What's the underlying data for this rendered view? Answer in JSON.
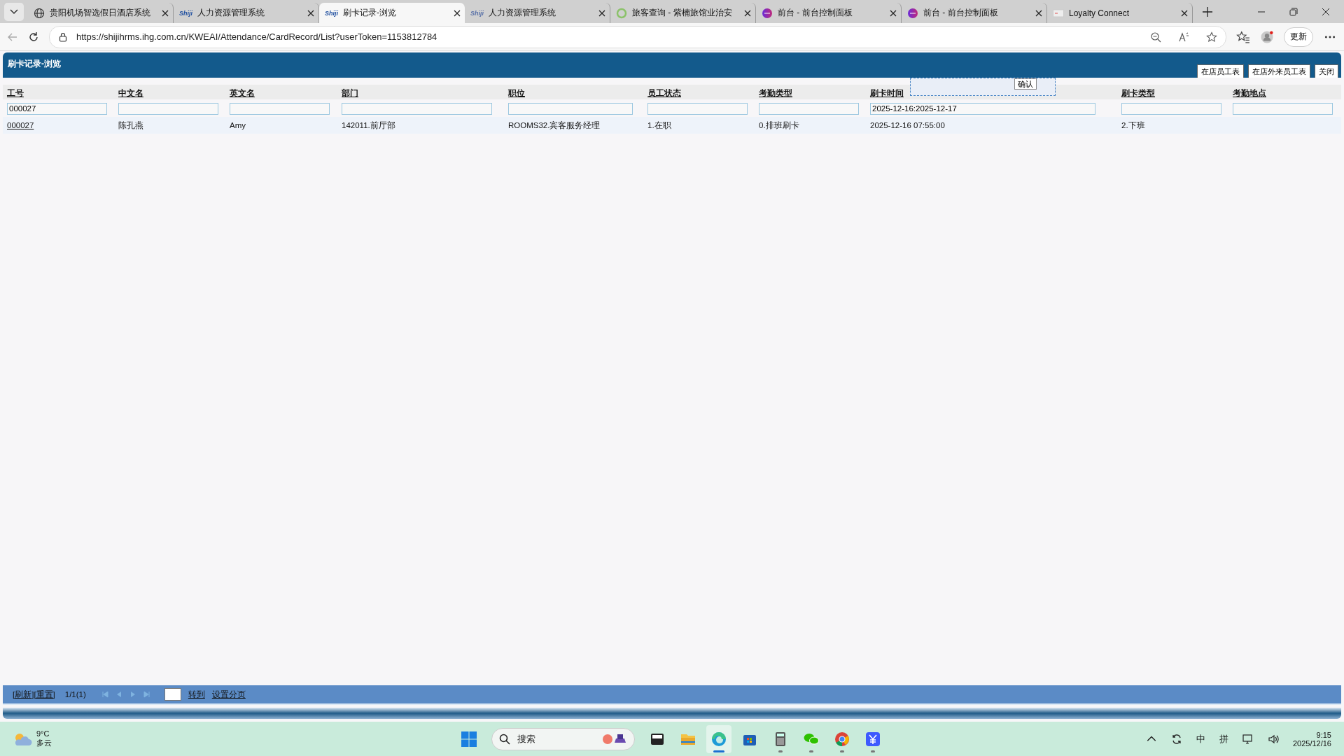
{
  "browser": {
    "tabs": [
      {
        "title": "贵阳机场智选假日酒店系统",
        "kind": "globe",
        "selected": false
      },
      {
        "title": "人力资源管理系统",
        "kind": "shiji",
        "icon_text": "Shiji",
        "selected": false
      },
      {
        "title": "刷卡记录-浏览",
        "kind": "shiji",
        "icon_text": "Shiji",
        "selected": true
      },
      {
        "title": "人力资源管理系统",
        "kind": "shiji-faded",
        "icon_text": "Shiji",
        "selected": false
      },
      {
        "title": "旅客查询 - 紫楠旅馆业治安",
        "kind": "ring",
        "selected": false
      },
      {
        "title": "前台 - 前台控制面板",
        "kind": "orb",
        "selected": false
      },
      {
        "title": "前台 - 前台控制面板",
        "kind": "orb",
        "selected": false
      },
      {
        "title": "Loyalty Connect",
        "kind": "card",
        "selected": false
      }
    ],
    "url": "https://shijihrms.ihg.com.cn/KWEAI/Attendance/CardRecord/List?userToken=1153812784",
    "update_button": "更新"
  },
  "page": {
    "title": "刷卡记录-浏览",
    "buttons": [
      "在店员工表",
      "在店外来员工表",
      "关闭"
    ],
    "popup": {
      "button": "确认"
    },
    "columns": [
      {
        "label": "工号",
        "filter": "000027"
      },
      {
        "label": "中文名"
      },
      {
        "label": "英文名"
      },
      {
        "label": "部门"
      },
      {
        "label": "职位"
      },
      {
        "label": "员工状态"
      },
      {
        "label": "考勤类型"
      },
      {
        "label": "刷卡时间",
        "filter": "2025-12-16:2025-12-17"
      },
      {
        "label": "刷卡类型"
      },
      {
        "label": "考勤地点"
      }
    ],
    "rows": [
      {
        "cells": [
          "000027",
          "陈孔燕",
          "Amy",
          "142011.前厅部",
          "ROOMS32.宾客服务经理",
          "1.在职",
          "0.排班刷卡",
          "2025-12-16 07:55:00",
          "2.下班"
        ]
      }
    ],
    "footer": {
      "refresh_link": "[刷新][重置]",
      "page_info": "1/1(1)",
      "goto_link": "转到",
      "paging_link": "设置分页"
    }
  },
  "taskbar": {
    "temperature": "9°C",
    "weather": "多云",
    "search_placeholder": "搜索",
    "apps": [
      {
        "kind": "files",
        "running": false,
        "active": false
      },
      {
        "kind": "folder",
        "running": false,
        "active": false
      },
      {
        "kind": "edge",
        "running": true,
        "active": true
      },
      {
        "kind": "store",
        "running": false,
        "active": false
      },
      {
        "kind": "calculator",
        "running": true,
        "active": false
      },
      {
        "kind": "chat",
        "running": true,
        "active": false
      },
      {
        "kind": "chrome",
        "running": true,
        "active": false
      },
      {
        "kind": "yuan",
        "running": true,
        "active": false
      }
    ],
    "ime_lang": "中",
    "ime_mode": "拼",
    "time": "9:15",
    "date": "2025/12/16"
  }
}
